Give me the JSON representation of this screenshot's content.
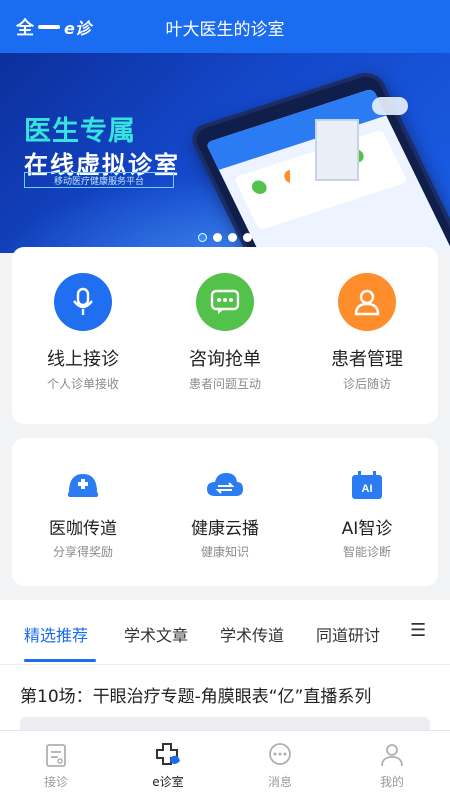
{
  "header": {
    "logo_text_left": "全",
    "logo_text_right": "e诊",
    "title": "叶大医生的诊室"
  },
  "banner": {
    "title_line1": "医生专属",
    "title_line2": "在线虚拟诊室",
    "subtitle": "移动医疗健康服务平台",
    "slides": 4,
    "active_slide": 0
  },
  "features_primary": [
    {
      "label": "线上接诊",
      "sub": "个人诊单接收",
      "icon": "microphone-icon",
      "color": "#1f6ff0"
    },
    {
      "label": "咨询抢单",
      "sub": "患者问题互动",
      "icon": "chat-bubble-icon",
      "color": "#53c24a"
    },
    {
      "label": "患者管理",
      "sub": "诊后随访",
      "icon": "user-icon",
      "color": "#ff8d2b"
    }
  ],
  "features_secondary": [
    {
      "label": "医咖传道",
      "sub": "分享得奖励",
      "icon": "helmet-plus-icon",
      "color": "#2b7bf3"
    },
    {
      "label": "健康云播",
      "sub": "健康知识",
      "icon": "cloud-sync-icon",
      "color": "#2b7bf3"
    },
    {
      "label": "AI智诊",
      "sub": "智能诊断",
      "icon": "ai-chip-icon",
      "color": "#2b7bf3"
    }
  ],
  "tabs": {
    "items": [
      "精选推荐",
      "学术文章",
      "学术传道",
      "同道研讨"
    ],
    "active": 0,
    "menu_icon": "hamburger-icon"
  },
  "feed": {
    "headline": "第10场：干眼治疗专题-角膜眼表“亿”直播系列"
  },
  "bottom_nav": {
    "items": [
      {
        "label": "接诊",
        "icon": "clipboard-icon"
      },
      {
        "label": "e诊室",
        "icon": "medical-cross-icon"
      },
      {
        "label": "消息",
        "icon": "message-icon"
      },
      {
        "label": "我的",
        "icon": "profile-icon"
      }
    ],
    "active": 1
  },
  "colors": {
    "primary": "#1a6cf0",
    "background": "#f2f3f5",
    "text": "#222222",
    "muted": "#8a8a8a"
  }
}
